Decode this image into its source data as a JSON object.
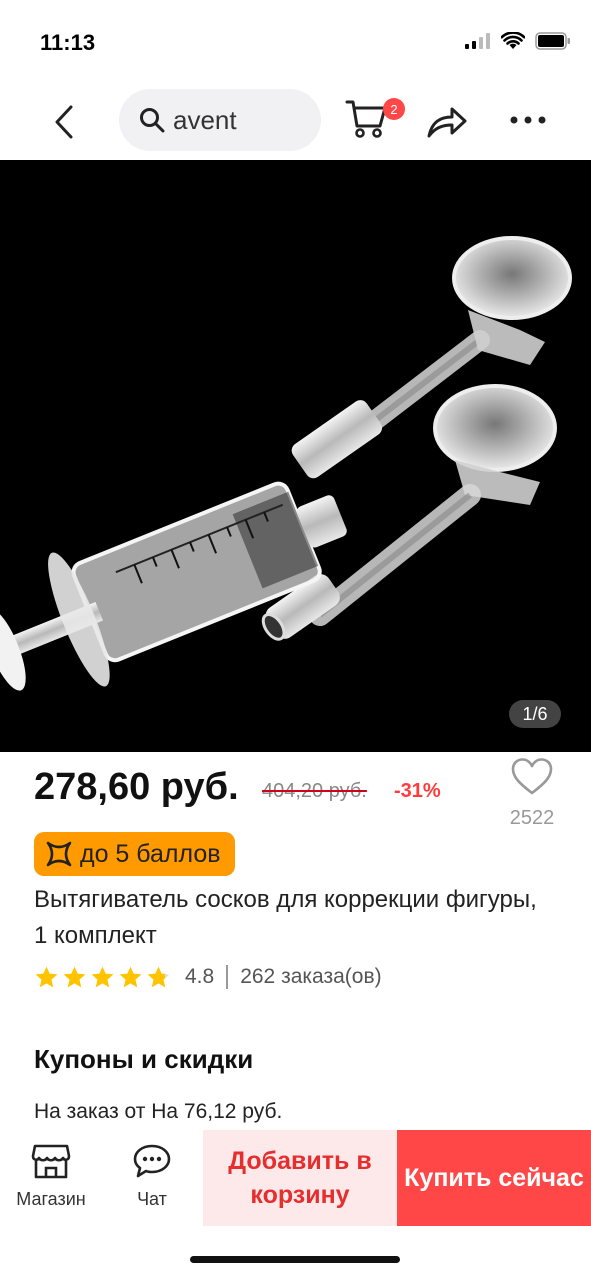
{
  "status_bar": {
    "time": "11:13"
  },
  "nav": {
    "search_text": "avent",
    "cart_count": "2"
  },
  "gallery": {
    "counter": "1/6"
  },
  "price": {
    "current": "278,60 руб.",
    "old": "404,20 руб.",
    "discount": "-31%"
  },
  "wishlist": {
    "count": "2522"
  },
  "points": {
    "label": "до 5 баллов"
  },
  "product": {
    "title": "Вытягиватель сосков для коррекции фигуры, 1 комплект",
    "rating": "4.8",
    "rating_value": 4.8,
    "orders": "262 заказа(ов)"
  },
  "coupons": {
    "title": "Купоны и скидки",
    "text": "На заказ от На 76,12 руб."
  },
  "bottom": {
    "store_label": "Магазин",
    "chat_label": "Чат",
    "add_cart_label": "Добавить в корзину",
    "buy_label": "Купить сейчас"
  },
  "colors": {
    "accent": "#ff4747",
    "points_badge": "#ff9a00",
    "star": "#ffc300"
  }
}
